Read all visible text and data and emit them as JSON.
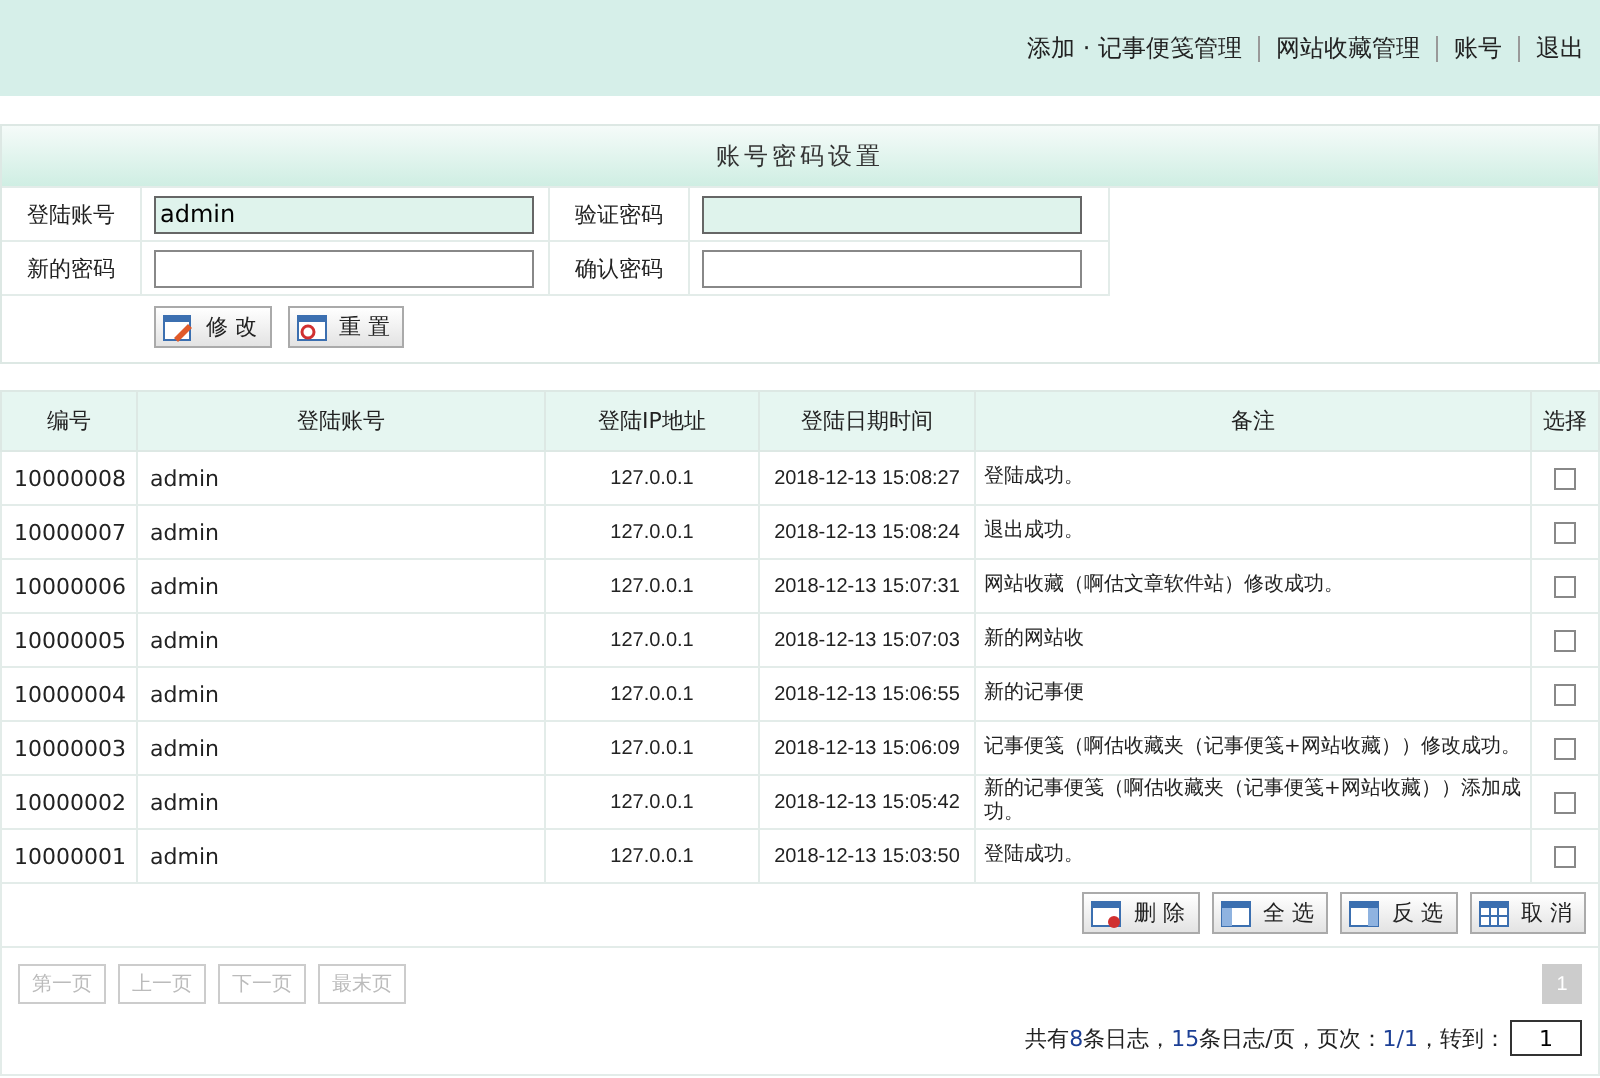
{
  "top_menu": [
    {
      "label": "添加 · 记事便笺管理"
    },
    {
      "label": "网站收藏管理"
    },
    {
      "label": "账号"
    },
    {
      "label": "退出"
    }
  ],
  "account_form": {
    "title": "账号密码设置",
    "fields": [
      {
        "label": "登陆账号",
        "value": "admin",
        "readonly": true
      },
      {
        "label": "验证密码",
        "readonly": true
      },
      {
        "label": "新的密码",
        "readonly": false
      },
      {
        "label": "确认密码",
        "readonly": false
      }
    ],
    "buttons": [
      {
        "label": "修 改",
        "kind": "edit"
      },
      {
        "label": "重 置",
        "kind": "reset"
      }
    ]
  },
  "log_table": {
    "columns": [
      "编号",
      "登陆账号",
      "登陆IP地址",
      "登陆日期时间",
      "备注",
      "选择"
    ],
    "rows": [
      {
        "id": "10000008",
        "account": "admin",
        "ip": "127.0.0.1",
        "time": "2018-12-13 15:08:27",
        "note": "登陆成功。",
        "checked": false
      },
      {
        "id": "10000007",
        "account": "admin",
        "ip": "127.0.0.1",
        "time": "2018-12-13 15:08:24",
        "note": "退出成功。",
        "checked": false
      },
      {
        "id": "10000006",
        "account": "admin",
        "ip": "127.0.0.1",
        "time": "2018-12-13 15:07:31",
        "note": "网站收藏（啊估文章软件站）修改成功。",
        "checked": false
      },
      {
        "id": "10000005",
        "account": "admin",
        "ip": "127.0.0.1",
        "time": "2018-12-13 15:07:03",
        "note": "新的网站收",
        "checked": false
      },
      {
        "id": "10000004",
        "account": "admin",
        "ip": "127.0.0.1",
        "time": "2018-12-13 15:06:55",
        "note": "新的记事便",
        "checked": false
      },
      {
        "id": "10000003",
        "account": "admin",
        "ip": "127.0.0.1",
        "time": "2018-12-13 15:06:09",
        "note": "记事便笺（啊估收藏夹（记事便笺+网站收藏））修改成功。",
        "checked": false
      },
      {
        "id": "10000002",
        "account": "admin",
        "ip": "127.0.0.1",
        "time": "2018-12-13 15:05:42",
        "note": "新的记事便笺（啊估收藏夹（记事便笺+网站收藏））添加成功。",
        "checked": false
      },
      {
        "id": "10000001",
        "account": "admin",
        "ip": "127.0.0.1",
        "time": "2018-12-13 15:03:50",
        "note": "登陆成功。",
        "checked": false
      }
    ],
    "actions": [
      {
        "label": "删 除",
        "kind": "delete"
      },
      {
        "label": "全 选",
        "kind": "select_all"
      },
      {
        "label": "反 选",
        "kind": "invert"
      },
      {
        "label": "取 消",
        "kind": "cancel"
      }
    ]
  },
  "pagination": {
    "buttons": [
      {
        "label": "第一页",
        "disabled": true
      },
      {
        "label": "上一页",
        "disabled": true
      },
      {
        "label": "下一页",
        "disabled": true
      },
      {
        "label": "最末页",
        "disabled": true
      }
    ],
    "pages": [
      {
        "label": "1",
        "selected": true
      }
    ],
    "summary": [
      {
        "text": "共有",
        "highlight": false
      },
      {
        "text": "8",
        "highlight": true
      },
      {
        "text": "条日志，",
        "highlight": false
      },
      {
        "text": "15",
        "highlight": true
      },
      {
        "text": "条日志/页，页次：",
        "highlight": false
      },
      {
        "text": "1/1",
        "highlight": true
      },
      {
        "text": "，转到：",
        "highlight": false
      }
    ],
    "goto_value": "1"
  }
}
